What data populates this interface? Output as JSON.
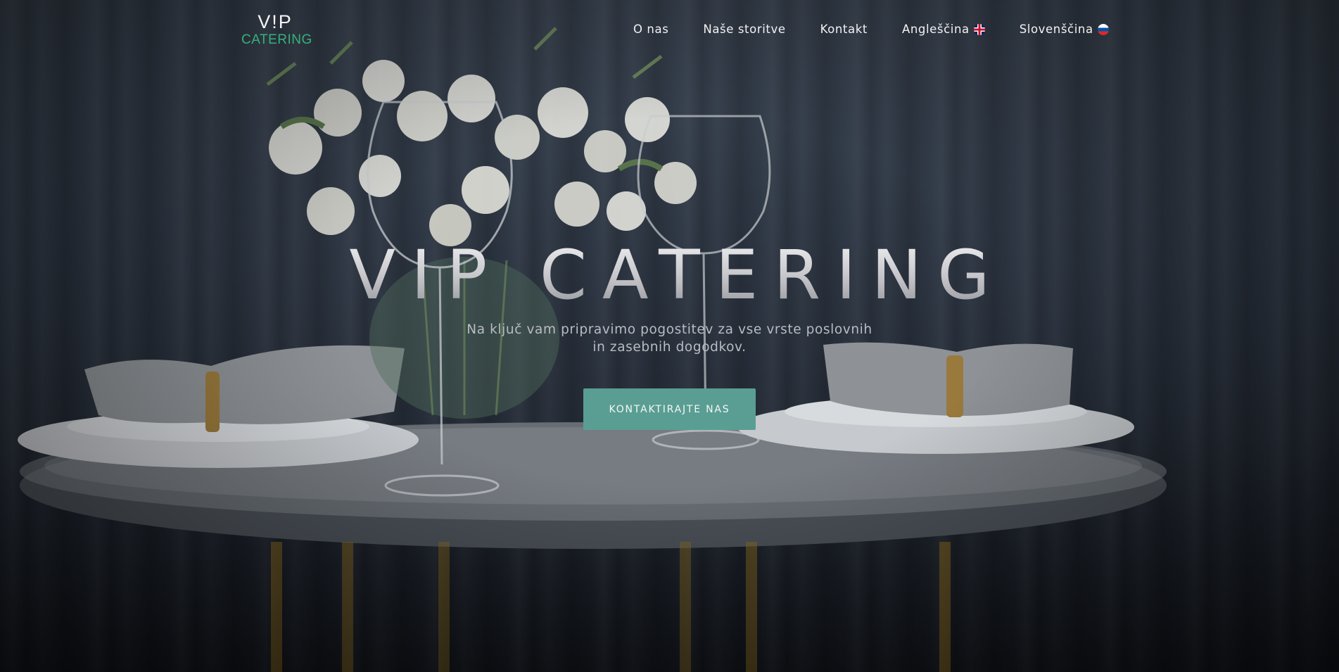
{
  "header": {
    "logo": {
      "top": "V!P",
      "bottom": "CATERING"
    },
    "nav": [
      {
        "label": "O nas"
      },
      {
        "label": "Naše storitve"
      },
      {
        "label": "Kontakt"
      },
      {
        "label": "Angleščina",
        "flag": "uk-flag-icon"
      },
      {
        "label": "Slovenščina",
        "flag": "slovenia-flag-icon"
      }
    ]
  },
  "hero": {
    "title": "VIP CATERING",
    "subtitle": "Na ključ vam pripravimo pogostitev za vse vrste poslovnih in zasebnih dogodkov.",
    "cta_label": "KONTAKTIRAJTE NAS"
  },
  "colors": {
    "brand_green": "#36b07e",
    "cta_background": "#5a9e93"
  }
}
